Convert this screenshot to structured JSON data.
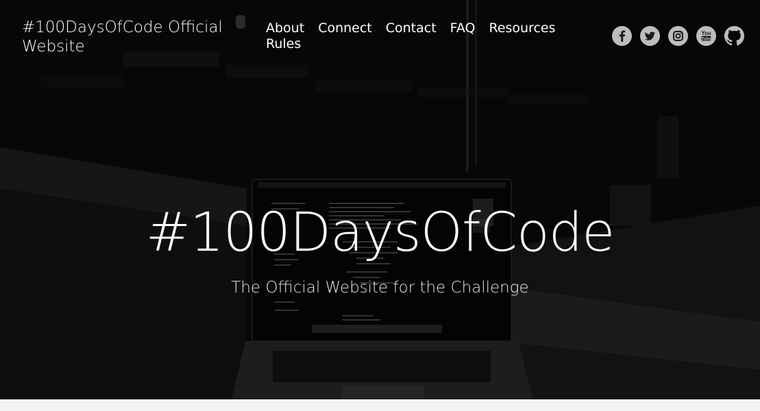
{
  "header": {
    "site_title": "#100DaysOfCode Official Website"
  },
  "nav": {
    "items": [
      {
        "label": "About"
      },
      {
        "label": "Connect"
      },
      {
        "label": "Contact"
      },
      {
        "label": "FAQ"
      },
      {
        "label": "Resources"
      },
      {
        "label": "Rules"
      }
    ]
  },
  "social": {
    "icons": [
      "facebook-icon",
      "twitter-icon",
      "instagram-icon",
      "youtube-icon",
      "github-icon"
    ],
    "youtube_text": "You\nTube",
    "facebook_glyph": "f"
  },
  "hero": {
    "headline": "#100DaysOfCode",
    "subheadline": "The Official Website for the Challenge"
  },
  "colors": {
    "hero_bg": "#0f0f0f",
    "text": "#ffffff",
    "icon_bg": "#bdbdbd",
    "page_bg": "#f4f4f4"
  }
}
